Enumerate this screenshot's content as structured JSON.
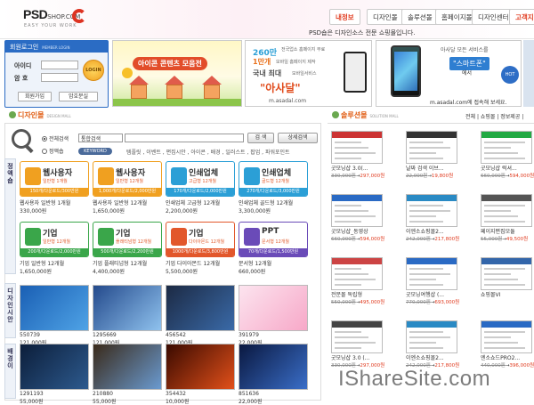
{
  "header": {
    "logo_main": "PSD",
    "logo_shop": "SHOP.COM",
    "logo_tag": "EASY YOUR WORK",
    "nav": [
      "내정보",
      "디자인몰",
      "솔루션몰",
      "홈페이지몰",
      "디자인센터",
      "고객지"
    ],
    "tagline": "PSD숍은 디자인소스 전문 쇼핑몰입니다."
  },
  "login": {
    "title": "회원로그인",
    "subtitle": "MEMBER LOGIN",
    "id_label": "아이디",
    "pw_label": "암 호",
    "login_btn": "LOGIN",
    "join_btn": "회원가입",
    "find_btn": "암호분실"
  },
  "banners": {
    "b1_title": "아이콘 콘텐츠 모음전",
    "b2_l1": "260만",
    "b2_l1b": "전국업소\n홈페이지 무료",
    "b2_l2": "1만개",
    "b2_l2b": "모바일 홈페이지 제작",
    "b2_l3": "국내 최대",
    "b2_l3b": "모바일서비스",
    "b2_big": "\"아사달\"",
    "b2_url": "m.asadal.com",
    "b3_l1": "아사달 모든 서비스를",
    "b3_l2": "\"스마트폰\"",
    "b3_l3": "에서",
    "b3_l4": "m.asadal.com에 접속해 보세요.",
    "b3_arrow": "HOT"
  },
  "design_mall": {
    "title": "디자인몰",
    "subtitle": "DESIGN MALL",
    "radio_all": "전체검색",
    "radio_fine": "정액숍",
    "select_value": "통합검색",
    "search_btn": "검 색",
    "detail_btn": "상세검색",
    "keyword_label": "KEYWORD",
    "keywords": "템플릿 , 이벤트 , 편집시안 , 아이콘 , 배경 , 일러스트 , 팝업 , 파워포인트",
    "vtab1": "정액숍",
    "vtab2": "디자인시안",
    "vtab3": "배경이",
    "cards": [
      {
        "name": "웹사용자",
        "sub": "일반형 1개월",
        "bar": "150개/다운로드/300만원",
        "desc": "웹사용자 일반형 1개월",
        "price": "330,000원",
        "color": "#f0a020"
      },
      {
        "name": "웹사용자",
        "sub": "일반형 12개월",
        "bar": "1,000개/다운로드/2,000만원",
        "desc": "웹사용자 일반형 12개월",
        "price": "1,650,000원",
        "color": "#f0a020"
      },
      {
        "name": "인쇄업체",
        "sub": "고급형 12개월",
        "bar": "170개/다운로드/2,000만원",
        "desc": "인쇄업체 고급형 12개월",
        "price": "2,200,000원",
        "color": "#2b9fd6"
      },
      {
        "name": "인쇄업체",
        "sub": "골드형 12개월",
        "bar": "270개/다운로드/3,000만원",
        "desc": "인쇄업체 골드형 12개월",
        "price": "3,300,000원",
        "color": "#2b9fd6"
      },
      {
        "name": "기업",
        "sub": "일반형 12개월",
        "bar": "200개/다운로드/2,000만원",
        "desc": "기업 일반형 12개월",
        "price": "1,650,000원",
        "color": "#3aa64a"
      },
      {
        "name": "기업",
        "sub": "플래티넘형 12개월",
        "bar": "500개/다운로드/2,200만원",
        "desc": "기업 플래티넘형 12개월",
        "price": "4,400,000원",
        "color": "#3aa64a"
      },
      {
        "name": "기업",
        "sub": "다이아몬드 12개월",
        "bar": "1000개/다운로드/3,800만원",
        "desc": "기업 다이아몬드 12개월",
        "price": "5,500,000원",
        "color": "#e2572b"
      },
      {
        "name": "PPT",
        "sub": "문서형 12개월",
        "bar": "70개/다운로드/1,500만원",
        "desc": "문서형 12개월",
        "price": "660,000원",
        "color": "#6a4bb8"
      }
    ],
    "thumbs_row1": [
      {
        "code": "550739",
        "price": "121,000원",
        "bg": "linear-gradient(135deg,#1a5fb4,#4fa3e6)"
      },
      {
        "code": "1295669",
        "price": "121,000원",
        "bg": "linear-gradient(135deg,#244a8c,#8fc2ee)"
      },
      {
        "code": "456542",
        "price": "121,000원",
        "bg": "linear-gradient(135deg,#1c2a44,#3a6aa8)"
      },
      {
        "code": "391979",
        "price": "22,000원",
        "bg": "linear-gradient(135deg,#fce4ef,#f7a8c8)"
      }
    ],
    "thumbs_row2": [
      {
        "code": "1291193",
        "price": "55,000원",
        "bg": "linear-gradient(135deg,#0c1e3a,#2d5a8e)"
      },
      {
        "code": "210880",
        "price": "55,000원",
        "bg": "linear-gradient(135deg,#3a2a1a,#6a9ad0)"
      },
      {
        "code": "354432",
        "price": "10,000원",
        "bg": "linear-gradient(135deg,#3a0a00,#e2501a)"
      },
      {
        "code": "851636",
        "price": "22,000원",
        "bg": "linear-gradient(135deg,#0a1840,#3a6ec8)"
      }
    ]
  },
  "solution_mall": {
    "title": "솔루션몰",
    "subtitle": "SOLUTION MALL",
    "nav": "전체 | 쇼핑몰 | 정보제공 |",
    "items": [
      {
        "code": "굿모닝샵 3.0(...",
        "old": "330,000원",
        "new": "297,000원",
        "hc": "#c33"
      },
      {
        "code": "날짜 검색 이브...",
        "old": "22,000원",
        "new": "19,800원",
        "hc": "#333"
      },
      {
        "code": "굿모닝샵 럭셔...",
        "old": "660,000원",
        "new": "594,000원",
        "hc": "#2a4"
      },
      {
        "code": "굿모닝샵_동영상",
        "old": "660,000원",
        "new": "594,000원",
        "hc": "#2a6ac4"
      },
      {
        "code": "이엔소쇼핑몰2...",
        "old": "242,000원",
        "new": "217,800원",
        "hc": "#2a8ac4"
      },
      {
        "code": "페이지편집모듈",
        "old": "55,000원",
        "new": "49,500원",
        "hc": "#555"
      },
      {
        "code": "전문몰 독립형",
        "old": "550,000원",
        "new": "495,000원",
        "hc": "#c44"
      },
      {
        "code": "굿모닝여행샵 (...",
        "old": "770,000원",
        "new": "693,000원",
        "hc": "#2a6ac4"
      },
      {
        "code": "쇼핑몰VI",
        "old": "",
        "new": "",
        "hc": "#36a"
      },
      {
        "code": "굿모닝샵 3.0 (...",
        "old": "330,000원",
        "new": "297,000원",
        "hc": "#444"
      },
      {
        "code": "이엔소쇼핑몰2...",
        "old": "242,000원",
        "new": "217,800원",
        "hc": "#2a8ac4"
      },
      {
        "code": "엔소쇼드PRO2...",
        "old": "440,000원",
        "new": "396,000원",
        "hc": "#2a6ac4"
      }
    ]
  },
  "watermark": "IShareSite.com"
}
